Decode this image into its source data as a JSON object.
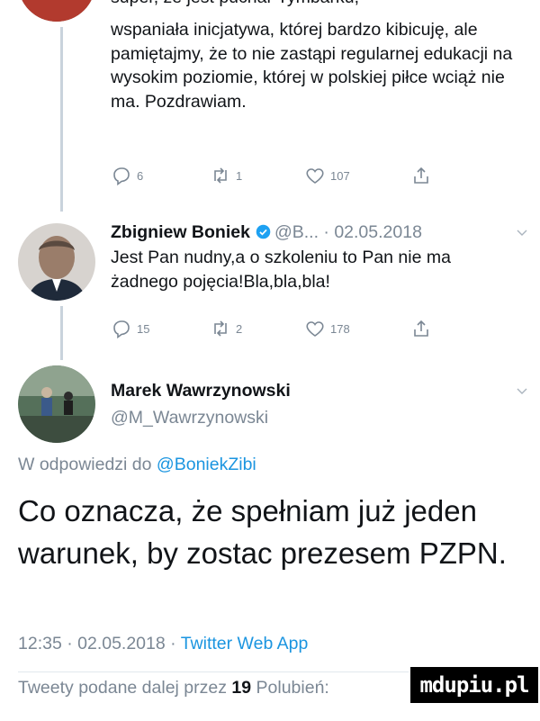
{
  "tweet1": {
    "cutoff_text": "super, że jest pucnar Tymbarku,",
    "text": "wspaniała inicjatywa, której bardzo kibicuję, ale pamiętajmy, że to nie zastąpi regularnej edukacji na wysokim poziomie, której w polskiej piłce wciąż nie ma. Pozdrawiam.",
    "replies": "6",
    "retweets": "1",
    "likes": "107"
  },
  "tweet2": {
    "name": "Zbigniew Boniek",
    "handle_date": "@B... · 02.05.2018",
    "text": "Jest Pan nudny,a o szkoleniu to Pan nie ma żadnego pojęcia!Bla,bla,bla!",
    "replies": "15",
    "retweets": "2",
    "likes": "178"
  },
  "main_tweet": {
    "name": "Marek Wawrzynowski",
    "handle": "@M_Wawrzynowski",
    "reply_prefix": "W odpowiedzi do",
    "reply_handle": "@BoniekZibi",
    "text": "Co oznacza, że spełniam już jeden warunek, by zostac prezesem PZPN.",
    "time": "12:35 · 02.05.2018 ·",
    "source": "Twitter Web App"
  },
  "footer": {
    "prefix": "Tweety podane dalej przez",
    "count": "19",
    "likes_label": "Polubień:"
  },
  "watermark": "mdupiu.pl",
  "colors": {
    "link": "#1b95e0",
    "muted": "#7b8794",
    "verified": "#1da1f2",
    "thread_line": "#c9d3dc"
  },
  "icons": [
    "reply-icon",
    "retweet-icon",
    "like-icon",
    "share-icon",
    "verified-icon",
    "chevron-down-icon"
  ]
}
